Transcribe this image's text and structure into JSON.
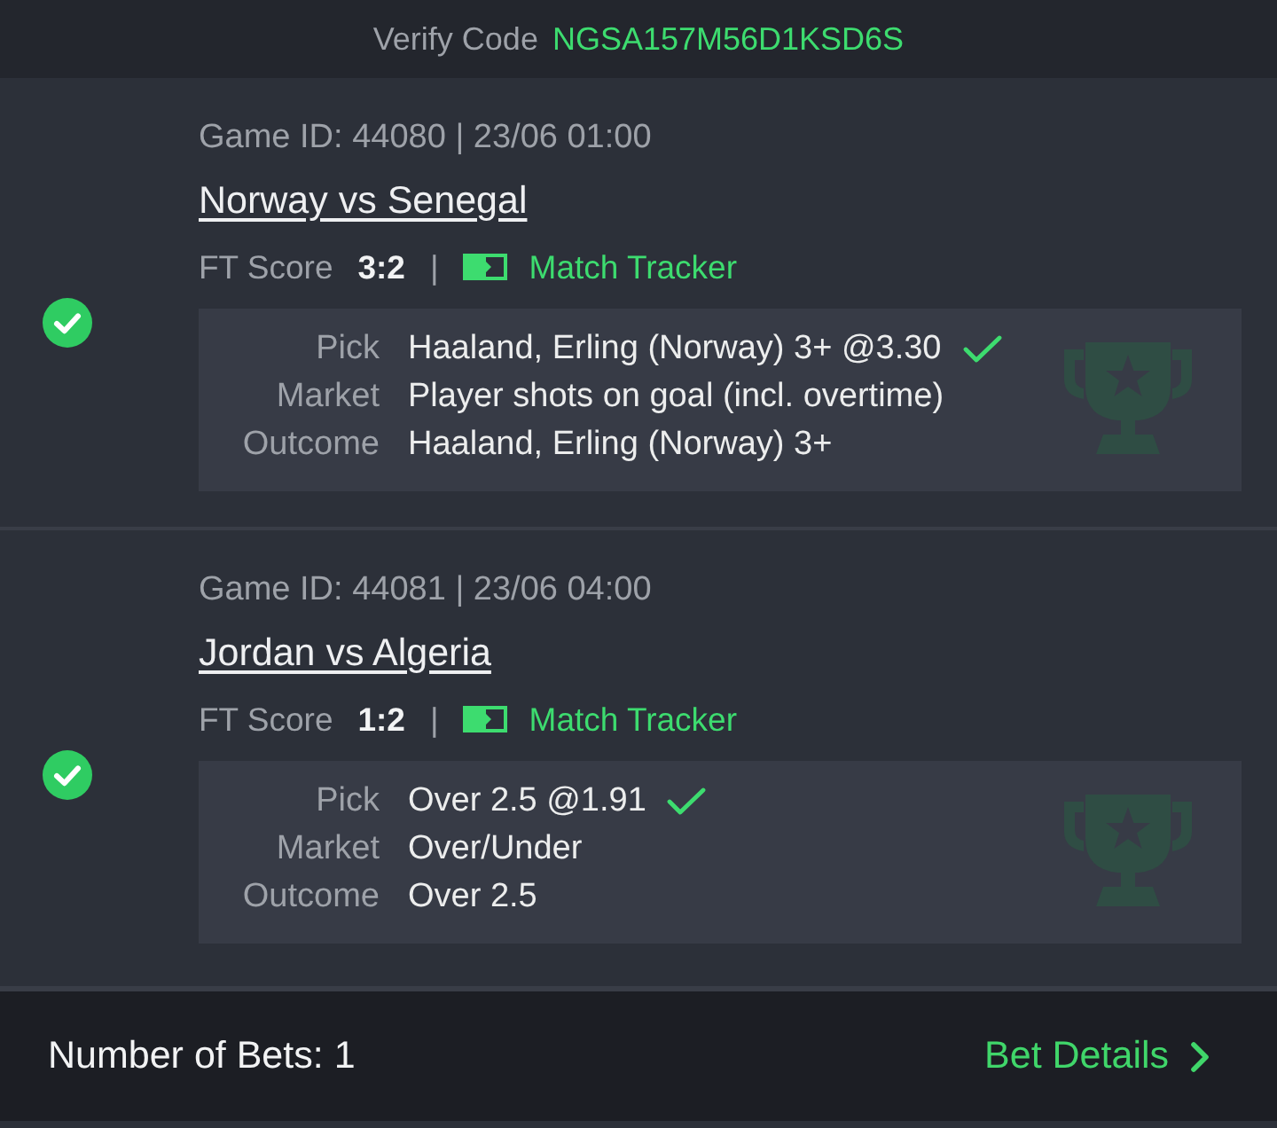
{
  "header": {
    "label": "Verify Code",
    "code": "NGSA157M56D1KSD6S"
  },
  "games": [
    {
      "won": true,
      "info": "Game ID: 44080 | 23/06 01:00",
      "title": "Norway vs Senegal",
      "score_label": "FT Score",
      "score": "3:2",
      "separator": "|",
      "tracker": "Match Tracker",
      "details": [
        {
          "label": "Pick",
          "value": "Haaland, Erling (Norway) 3+ @3.30",
          "ticked": true
        },
        {
          "label": "Market",
          "value": "Player shots on goal (incl. overtime)",
          "ticked": false
        },
        {
          "label": "Outcome",
          "value": "Haaland, Erling (Norway) 3+",
          "ticked": false
        }
      ]
    },
    {
      "won": true,
      "info": "Game ID: 44081 | 23/06 04:00",
      "title": "Jordan vs Algeria",
      "score_label": "FT Score",
      "score": "1:2",
      "separator": "|",
      "tracker": "Match Tracker",
      "details": [
        {
          "label": "Pick",
          "value": "Over 2.5 @1.91",
          "ticked": true
        },
        {
          "label": "Market",
          "value": "Over/Under",
          "ticked": false
        },
        {
          "label": "Outcome",
          "value": "Over 2.5",
          "ticked": false
        }
      ]
    }
  ],
  "footer": {
    "bets": "Number of Bets: 1",
    "details_link": "Bet Details"
  }
}
